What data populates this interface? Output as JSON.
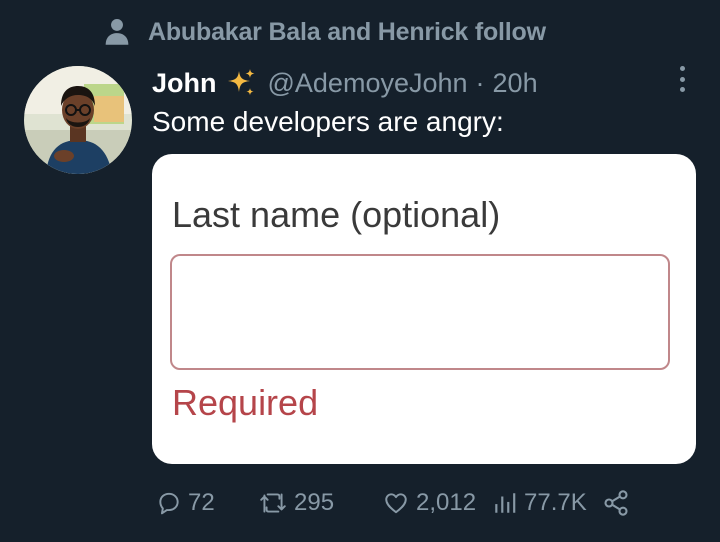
{
  "social_context": {
    "text": "Abubakar Bala and Henrick follow",
    "icon": "person-icon"
  },
  "tweet": {
    "display_name": "John",
    "name_emoji": "sparkles-icon",
    "handle": "@AdemoyeJohn",
    "separator": "·",
    "timestamp": "20h",
    "text": "Some developers are angry:"
  },
  "media": {
    "field_label": "Last name (optional)",
    "input_value": "",
    "error_text": "Required",
    "colors": {
      "label": "#3a3a3a",
      "border": "#c0878a",
      "error": "#b5454a"
    }
  },
  "actions": {
    "replies": "72",
    "retweets": "295",
    "likes": "2,012",
    "views": "77.7K"
  },
  "colors": {
    "background": "#15202b",
    "muted": "#8899a6",
    "text": "#ffffff"
  }
}
